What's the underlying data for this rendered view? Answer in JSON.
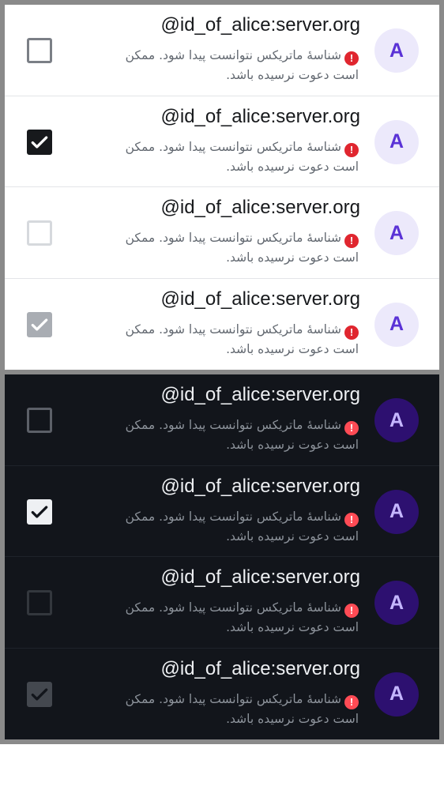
{
  "user": {
    "id": "@id_of_alice:server.org",
    "avatar_letter": "A",
    "error_text": "شناسهٔ ماتریکس نتوانست پیدا شود. ممکن است دعوت نرسیده باشد.",
    "error_icon": "exclamation-icon",
    "error_icon_glyph": "!"
  },
  "themes": [
    {
      "name": "light",
      "rows": [
        {
          "checkbox_state": "unchecked"
        },
        {
          "checkbox_state": "checked"
        },
        {
          "checkbox_state": "disabled-unchecked"
        },
        {
          "checkbox_state": "disabled-checked"
        }
      ]
    },
    {
      "name": "dark",
      "rows": [
        {
          "checkbox_state": "unchecked"
        },
        {
          "checkbox_state": "checked"
        },
        {
          "checkbox_state": "disabled-unchecked"
        },
        {
          "checkbox_state": "disabled-checked"
        }
      ]
    }
  ],
  "colors": {
    "light_accent": "#5a32d6",
    "dark_accent": "#c5b7ff",
    "error_red": "#e0262f"
  }
}
